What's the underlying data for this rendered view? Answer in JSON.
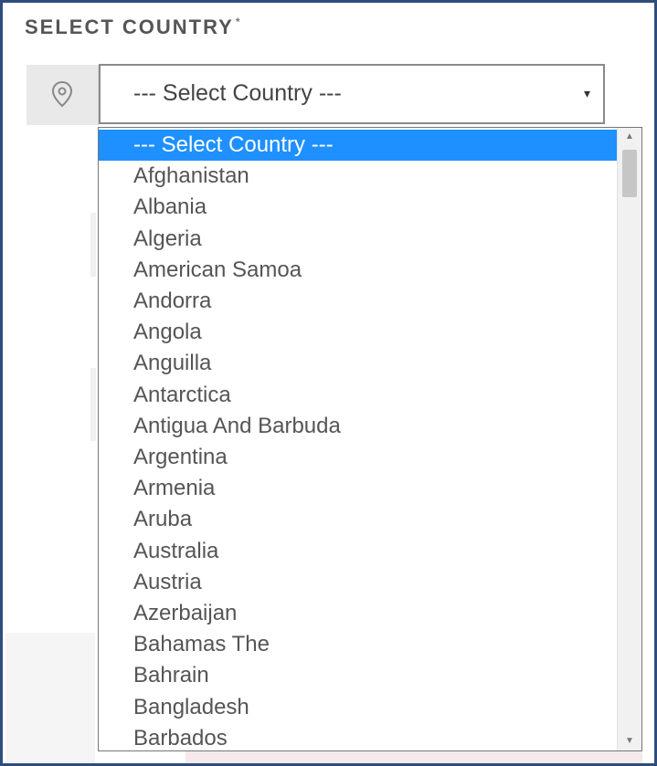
{
  "field": {
    "label": "SELECT COUNTRY",
    "required_mark": "*",
    "selected_value": "--- Select Country ---",
    "caret": "▾",
    "addon_icon": "map-pin-icon"
  },
  "dropdown": {
    "options": [
      "--- Select Country ---",
      "Afghanistan",
      "Albania",
      "Algeria",
      "American Samoa",
      "Andorra",
      "Angola",
      "Anguilla",
      "Antarctica",
      "Antigua And Barbuda",
      "Argentina",
      "Armenia",
      "Aruba",
      "Australia",
      "Austria",
      "Azerbaijan",
      "Bahamas The",
      "Bahrain",
      "Bangladesh",
      "Barbados"
    ],
    "highlighted_index": 0,
    "scroll_up": "▲",
    "scroll_down": "▼"
  },
  "colors": {
    "highlight": "#1e90ff",
    "frame_border": "#2f4d7c"
  }
}
